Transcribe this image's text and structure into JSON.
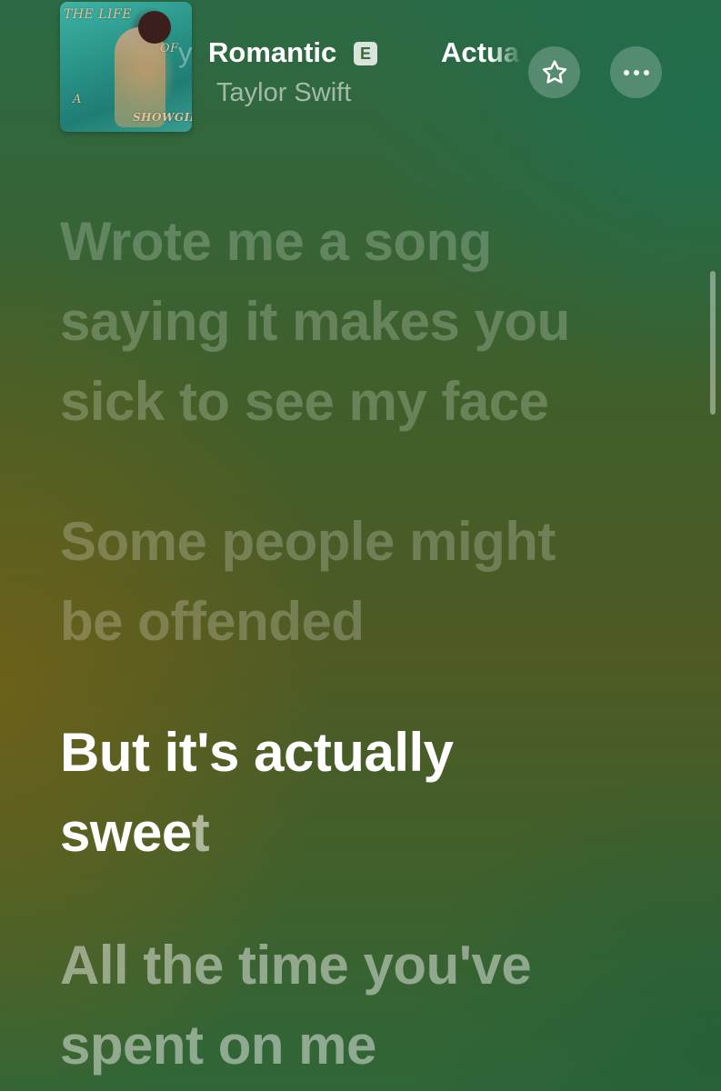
{
  "now_playing": {
    "title": "Romantic",
    "title_prefix_fade": "y",
    "explicit_badge": "E",
    "next_title": "Actua",
    "artist": "Taylor Swift",
    "artwork": {
      "text_title": "THE LIFE",
      "text_of": "OF",
      "text_a": "A",
      "text_showgirl": "SHOWGIRL"
    }
  },
  "controls": {
    "favorite_icon": "star-icon",
    "more_icon": "ellipsis-icon"
  },
  "lyrics": {
    "block1": [
      "Wrote me a song",
      "saying it makes you",
      "sick to see my face"
    ],
    "block2": [
      "Some people might",
      "be offended"
    ],
    "block3_line1": "But it's actually",
    "block3_line2_sung": "swee",
    "block3_line2_unsung": "t",
    "block4": [
      "All the time you've",
      "spent on me"
    ]
  },
  "colors": {
    "accent_active_lyric": "#ffffff",
    "background_top": "#2b6a45",
    "background_mid": "#4f5a24"
  }
}
